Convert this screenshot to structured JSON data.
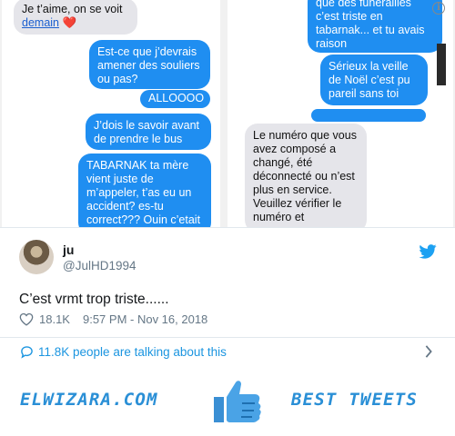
{
  "screenshots": {
    "left_conversation": {
      "messages": [
        {
          "from": "other",
          "text_part1": "Je t’aime, on se voit",
          "link_text": "demain",
          "emoji": "❤️"
        },
        {
          "from": "me",
          "text": "Est-ce que j’devrais amener des souliers ou pas?"
        },
        {
          "from": "me",
          "text": "ALLOOOO"
        },
        {
          "from": "me",
          "text": "J’dois le savoir avant de prendre le bus"
        },
        {
          "from": "me",
          "text": "TABARNAK ta mère vient juste de m’appeler, t’as eu un accident? es-tu correct??? Ouin c’etait"
        }
      ]
    },
    "right_conversation": {
      "info_icon": "i",
      "messages": [
        {
          "from": "me",
          "text": "que des funérailles c’est triste en tabarnak... et tu avais raison"
        },
        {
          "from": "me",
          "text": "Sérieux la veille de Noël c’est pu pareil sans toi"
        },
        {
          "from": "me",
          "text": ""
        },
        {
          "from": "other",
          "text": "Le numéro que vous avez composé a changé, été déconnecté ou n’est plus en service. Veuillez vérifier le numéro et"
        }
      ]
    },
    "side_tag_color": "#2a2a2a"
  },
  "tweet": {
    "author_name": "ju",
    "handle": "@JulHD1994",
    "text": "C’est vrmt trop triste......",
    "likes": "18.1K",
    "timestamp": "9:57 PM - Nov 16, 2018",
    "talking_about": "11.8K people are talking about this",
    "accent_color": "#1b95e0"
  },
  "footer": {
    "brand": "ELWIZARA.COM",
    "tagline": "BEST TWEETS",
    "color": "#2a8fd6"
  }
}
